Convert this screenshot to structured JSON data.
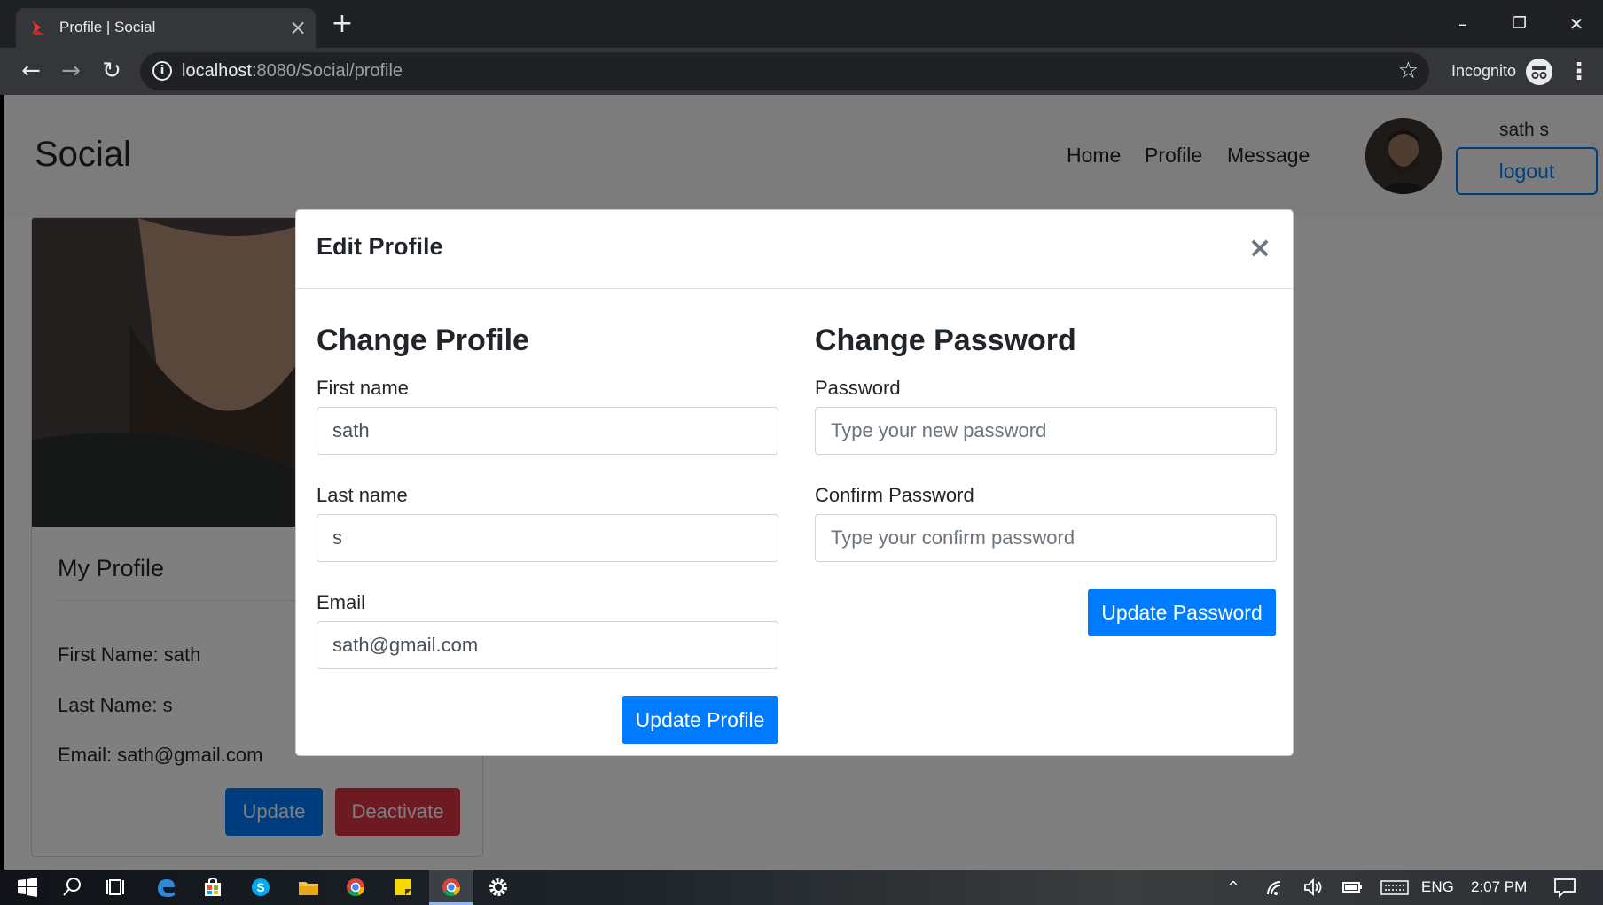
{
  "browser": {
    "tab_title": "Profile | Social",
    "tab_close": "×",
    "new_tab": "+",
    "url_host": "localhost",
    "url_rest": ":8080/Social/profile",
    "incognito_label": "Incognito",
    "win_minimize": "–",
    "win_restore": "❐",
    "win_close": "✕",
    "back": "←",
    "forward": "→",
    "reload": "↻",
    "star": "☆",
    "menu": "⋮"
  },
  "navbar": {
    "brand": "Social",
    "links": [
      "Home",
      "Profile",
      "Message"
    ],
    "username": "sath s",
    "logout_label": "logout"
  },
  "profile_card": {
    "title": "My Profile",
    "first_name": "First Name: sath",
    "last_name": "Last Name: s",
    "email": "Email: sath@gmail.com",
    "update_label": "Update",
    "deactivate_label": "Deactivate"
  },
  "modal": {
    "title": "Edit Profile",
    "close_label": "×",
    "change_profile": {
      "heading": "Change Profile",
      "first_name_label": "First name",
      "first_name_value": "sath",
      "last_name_label": "Last name",
      "last_name_value": "s",
      "email_label": "Email",
      "email_value": "sath@gmail.com",
      "submit_label": "Update Profile"
    },
    "change_password": {
      "heading": "Change Password",
      "password_label": "Password",
      "password_placeholder": "Type your new password",
      "confirm_label": "Confirm Password",
      "confirm_placeholder": "Type your confirm password",
      "submit_label": "Update Password"
    }
  },
  "taskbar": {
    "language": "ENG",
    "time": "2:07 PM"
  },
  "colors": {
    "primary": "#007bff",
    "danger": "#dc3545",
    "chrome_dark": "#202124",
    "chrome_toolbar": "#35363a"
  }
}
